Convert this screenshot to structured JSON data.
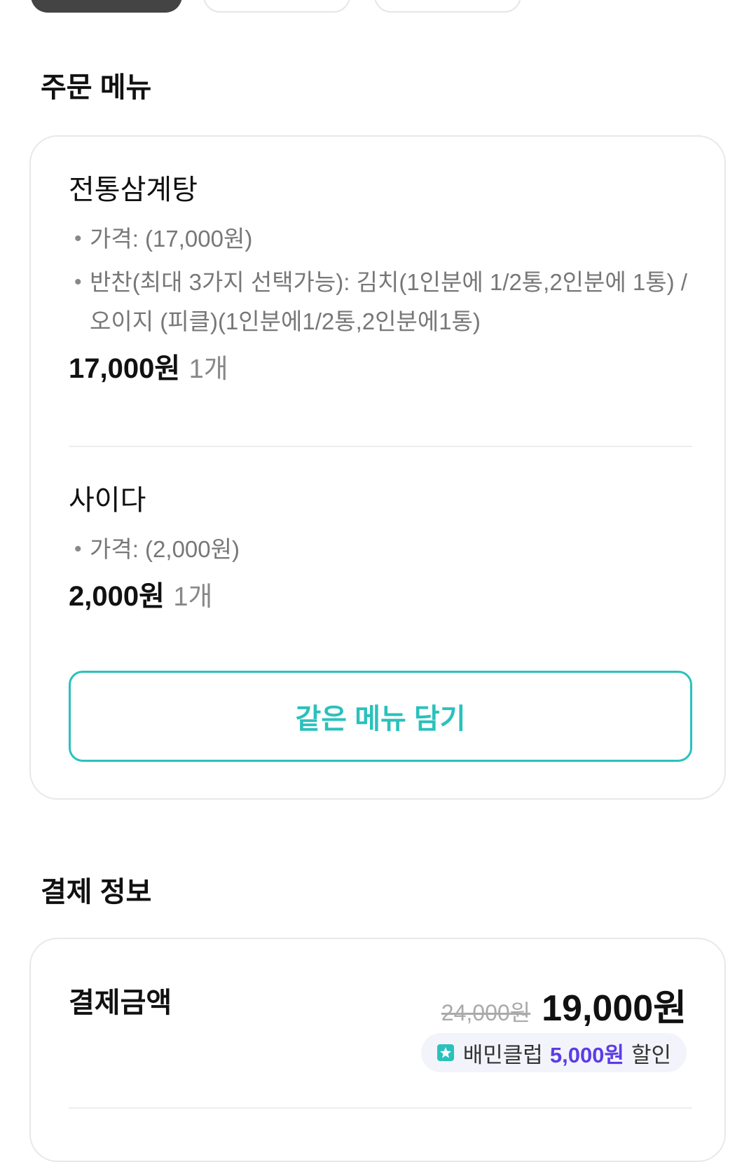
{
  "order_section": {
    "title": "주문 메뉴",
    "items": [
      {
        "name": "전통삼계탕",
        "details": [
          "가격: (17,000원)",
          "반찬(최대 3가지 선택가능): 김치(1인분에 1/2통,2인분에 1통) / 오이지 (피클)(1인분에1/2통,2인분에1통)"
        ],
        "price": "17,000원",
        "quantity": "1개"
      },
      {
        "name": "사이다",
        "details": [
          "가격: (2,000원)"
        ],
        "price": "2,000원",
        "quantity": "1개"
      }
    ],
    "same_menu_button": "같은 메뉴 담기"
  },
  "payment_section": {
    "title": "결제 정보",
    "amount_label": "결제금액",
    "original_price": "24,000원",
    "final_price": "19,000원",
    "discount": {
      "icon": "baemin-club-icon",
      "prefix": "배민클럽",
      "amount": "5,000원",
      "suffix": "할인"
    }
  },
  "colors": {
    "accent": "#2ac1bc",
    "club_purple": "#5b3ce6",
    "tab_active": "#444444"
  }
}
